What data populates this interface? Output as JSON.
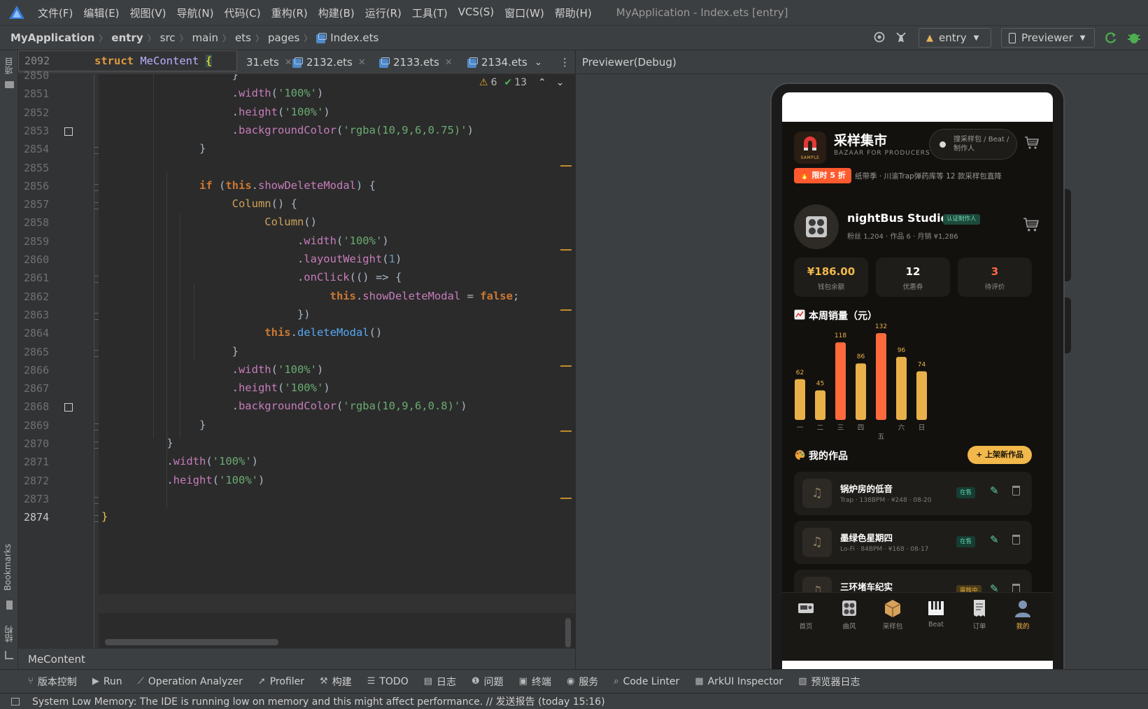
{
  "menubar": {
    "items": [
      "文件(F)",
      "编辑(E)",
      "视图(V)",
      "导航(N)",
      "代码(C)",
      "重构(R)",
      "构建(B)",
      "运行(R)",
      "工具(T)",
      "VCS(S)",
      "窗口(W)",
      "帮助(H)"
    ],
    "window_title": "MyApplication - Index.ets [entry]"
  },
  "breadcrumb": [
    "MyApplication",
    "entry",
    "src",
    "main",
    "ets",
    "pages",
    "Index.ets"
  ],
  "toolbar": {
    "module": "entry",
    "run_config": "Previewer"
  },
  "left_strip": {
    "project": "项目",
    "bookmarks": "Bookmarks",
    "structure": "结构"
  },
  "tabs": [
    {
      "label": "31.ets"
    },
    {
      "label": "2132.ets"
    },
    {
      "label": "2133.ets"
    },
    {
      "label": "2134.ets"
    }
  ],
  "sticky": {
    "line": "2092",
    "code": "struct MeContent {"
  },
  "inspections": {
    "warnings": "6",
    "ok": "13"
  },
  "editor": {
    "lines": [
      "2850",
      "2851",
      "2852",
      "2853",
      "2854",
      "2855",
      "2856",
      "2857",
      "2858",
      "2859",
      "2860",
      "2861",
      "2862",
      "2863",
      "2864",
      "2865",
      "2866",
      "2867",
      "2868",
      "2869",
      "2870",
      "2871",
      "2872",
      "2873",
      "2874"
    ]
  },
  "code_bread": "MeContent",
  "previewer": {
    "title": "Previewer(Debug)"
  },
  "app": {
    "brand_title": "采样集市",
    "brand_sub": "BAZAAR FOR PRODUCERS",
    "logo_text": "SAMPLE",
    "search_placeholder": "搜采样包 / Beat / 制作人",
    "promo_tag": "🔥 限时 5 折",
    "promo_text": "纸带季 · 川渝Trap弹药库等 12 款采样包直降",
    "profile_name": "nightBus Studio",
    "profile_badge": "认证制作人",
    "profile_meta": "粉丝 1,204 · 作品 6 · 月销 ¥1,286",
    "stats": [
      {
        "value": "¥186.00",
        "label": "钱包余额",
        "color": "#f2b84b"
      },
      {
        "value": "12",
        "label": "优惠券",
        "color": "#ffffff"
      },
      {
        "value": "3",
        "label": "待评价",
        "color": "#ff6a3d"
      }
    ],
    "sales_title": "本周销量（元）",
    "works_title": "我的作品",
    "add_work": "+ 上架新作品",
    "works": [
      {
        "title": "锅炉房的低音",
        "meta": "Trap · 138BPM · ¥248 · 08-20",
        "status": "在售"
      },
      {
        "title": "墨绿色星期四",
        "meta": "Lo-Fi · 84BPM · ¥168 · 08-17",
        "status": "在售"
      },
      {
        "title": "三环堵车纪实",
        "meta": "",
        "status": "审核中"
      }
    ],
    "tabbar": [
      {
        "label": "首页",
        "icon": "radio-icon"
      },
      {
        "label": "曲风",
        "icon": "speaker-icon"
      },
      {
        "label": "采样包",
        "icon": "package-icon"
      },
      {
        "label": "Beat",
        "icon": "piano-icon"
      },
      {
        "label": "订单",
        "icon": "receipt-icon"
      },
      {
        "label": "我的",
        "icon": "user-icon",
        "active": true
      }
    ]
  },
  "chart_data": {
    "type": "bar",
    "title": "本周销量（元）",
    "categories": [
      "一",
      "二",
      "三",
      "四",
      "五",
      "六",
      "日"
    ],
    "values": [
      62,
      45,
      118,
      86,
      132,
      96,
      74
    ],
    "highlight": [
      "三",
      "五"
    ],
    "colors": {
      "normal": "#e8b14a",
      "highlight": "#ff6a3d"
    },
    "ylim": [
      0,
      132
    ],
    "grid": false,
    "legend": "none"
  },
  "bottom_tools": [
    {
      "label": "版本控制",
      "icon": "vcs-icon"
    },
    {
      "label": "Run",
      "icon": "run-icon"
    },
    {
      "label": "Operation Analyzer",
      "icon": "analyzer-icon"
    },
    {
      "label": "Profiler",
      "icon": "profiler-icon"
    },
    {
      "label": "构建",
      "icon": "hammer-icon"
    },
    {
      "label": "TODO",
      "icon": "list-icon"
    },
    {
      "label": "日志",
      "icon": "log-icon"
    },
    {
      "label": "问题",
      "icon": "info-icon"
    },
    {
      "label": "终端",
      "icon": "terminal-icon"
    },
    {
      "label": "服务",
      "icon": "service-icon"
    },
    {
      "label": "Code Linter",
      "icon": "search-icon"
    },
    {
      "label": "ArkUI Inspector",
      "icon": "inspector-icon"
    },
    {
      "label": "预览器日志",
      "icon": "doc-icon"
    }
  ],
  "status_message": "System Low Memory: The IDE is running low on memory and this might affect performance. // 发送报告 (today 15:16)"
}
